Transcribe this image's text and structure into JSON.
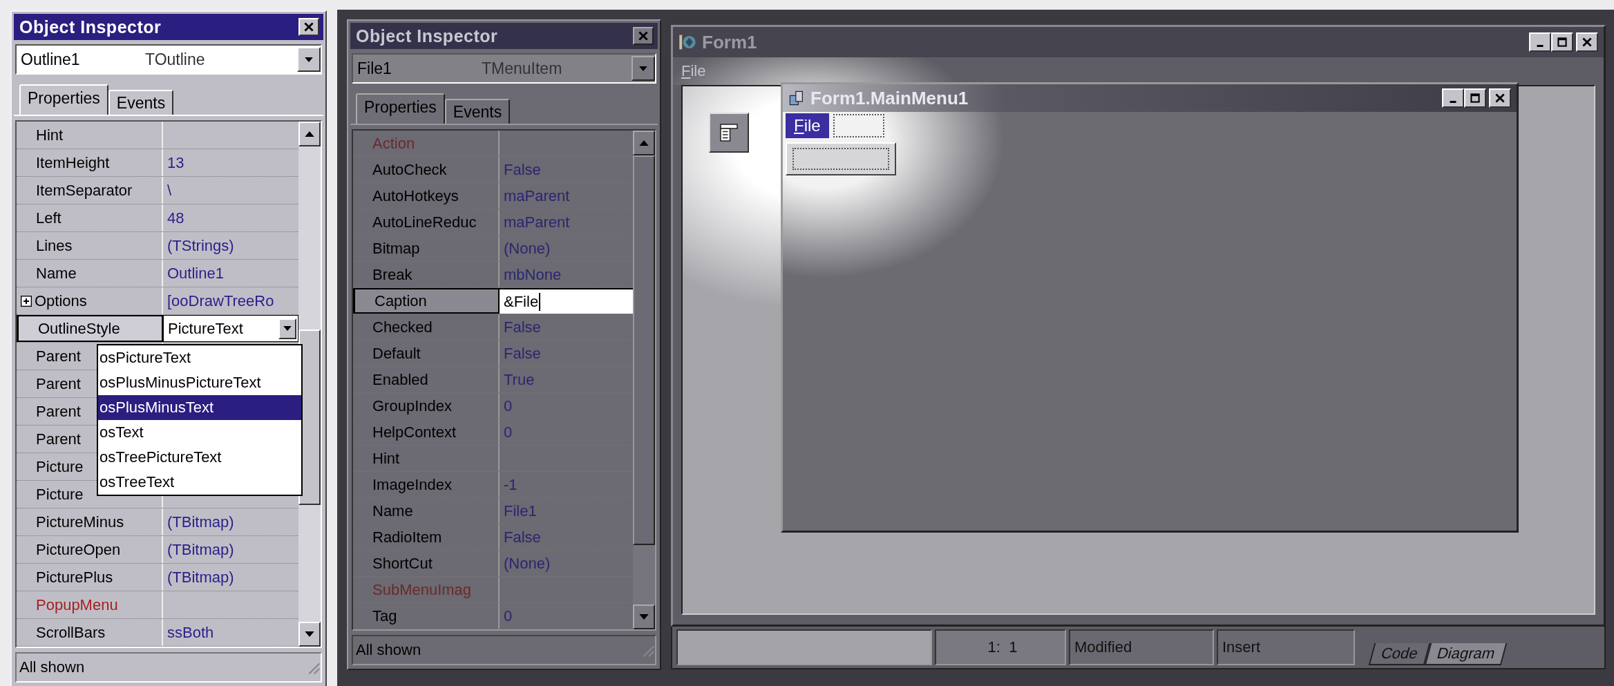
{
  "inspectors": [
    {
      "title": "Object Inspector",
      "dimmed": false,
      "object": {
        "name": "Outline1",
        "type": "TOutline"
      },
      "tabs": [
        {
          "label": "Properties",
          "selected": true
        },
        {
          "label": "Events",
          "selected": false
        }
      ],
      "rows": [
        {
          "name": "Hint",
          "kind": "plain",
          "selected": false
        },
        {
          "name": "ItemHeight",
          "value": "13",
          "kind": "plain",
          "selected": false
        },
        {
          "name": "ItemSeparator",
          "value": "\\",
          "kind": "plain",
          "selected": false
        },
        {
          "name": "Left",
          "value": "48",
          "kind": "plain",
          "selected": false
        },
        {
          "name": "Lines",
          "value": "(TStrings)",
          "kind": "plain",
          "selected": false
        },
        {
          "name": "Name",
          "value": "Outline1",
          "kind": "plain",
          "selected": false
        },
        {
          "name": "Options",
          "value": "[ooDrawTreeRo",
          "kind": "set",
          "selected": false
        },
        {
          "name": "OutlineStyle",
          "value": "PictureText",
          "kind": "combo",
          "selected": true
        },
        {
          "name": "Parent",
          "kind": "plain",
          "selected": false
        },
        {
          "name": "Parent",
          "kind": "plain",
          "selected": false
        },
        {
          "name": "Parent",
          "kind": "plain",
          "selected": false
        },
        {
          "name": "Parent",
          "kind": "plain",
          "selected": false
        },
        {
          "name": "Picture",
          "kind": "plain",
          "selected": false
        },
        {
          "name": "Picture",
          "kind": "plain",
          "selected": false
        },
        {
          "name": "PictureMinus",
          "value": "(TBitmap)",
          "kind": "plain",
          "selected": false
        },
        {
          "name": "PictureOpen",
          "value": "(TBitmap)",
          "kind": "plain",
          "selected": false
        },
        {
          "name": "PicturePlus",
          "value": "(TBitmap)",
          "kind": "plain",
          "selected": false
        },
        {
          "name": "PopupMenu",
          "kind": "reference",
          "selected": false
        },
        {
          "name": "ScrollBars",
          "value": "ssBoth",
          "kind": "plain",
          "selected": false
        }
      ],
      "dropdown": [
        {
          "label": "osPictureText",
          "selected": false
        },
        {
          "label": "osPlusMinusPictureText",
          "selected": false
        },
        {
          "label": "osPlusMinusText",
          "selected": true
        },
        {
          "label": "osText",
          "selected": false
        },
        {
          "label": "osTreePictureText",
          "selected": false
        },
        {
          "label": "osTreeText",
          "selected": false
        }
      ],
      "status": "All shown"
    },
    {
      "title": "Object Inspector",
      "dimmed": true,
      "object": {
        "name": "File1",
        "type": "TMenuItem"
      },
      "tabs": [
        {
          "label": "Properties",
          "selected": true
        },
        {
          "label": "Events",
          "selected": false
        }
      ],
      "rows": [
        {
          "name": "Action",
          "kind": "reference",
          "selected": false
        },
        {
          "name": "AutoCheck",
          "value": "False",
          "kind": "plain",
          "selected": false
        },
        {
          "name": "AutoHotkeys",
          "value": "maParent",
          "kind": "plain",
          "selected": false
        },
        {
          "name": "AutoLineReduc",
          "value": "maParent",
          "kind": "plain",
          "selected": false
        },
        {
          "name": "Bitmap",
          "value": "(None)",
          "kind": "plain",
          "selected": false
        },
        {
          "name": "Break",
          "value": "mbNone",
          "kind": "plain",
          "selected": false
        },
        {
          "name": "Caption",
          "value": "&File",
          "kind": "edit",
          "selected": true
        },
        {
          "name": "Checked",
          "value": "False",
          "kind": "plain",
          "selected": false
        },
        {
          "name": "Default",
          "value": "False",
          "kind": "plain",
          "selected": false
        },
        {
          "name": "Enabled",
          "value": "True",
          "kind": "plain",
          "selected": false
        },
        {
          "name": "GroupIndex",
          "value": "0",
          "kind": "plain",
          "selected": false
        },
        {
          "name": "HelpContext",
          "value": "0",
          "kind": "plain",
          "selected": false
        },
        {
          "name": "Hint",
          "kind": "plain",
          "selected": false
        },
        {
          "name": "ImageIndex",
          "value": "-1",
          "kind": "plain",
          "selected": false
        },
        {
          "name": "Name",
          "value": "File1",
          "kind": "plain",
          "selected": false
        },
        {
          "name": "RadioItem",
          "value": "False",
          "kind": "plain",
          "selected": false
        },
        {
          "name": "ShortCut",
          "value": "(None)",
          "kind": "plain",
          "selected": false
        },
        {
          "name": "SubMenuImag",
          "kind": "reference",
          "selected": false
        },
        {
          "name": "Tag",
          "value": "0",
          "kind": "plain",
          "selected": false
        }
      ],
      "status": "All shown"
    }
  ],
  "form": {
    "title": "Form1",
    "menu": [
      "File"
    ],
    "designer": {
      "title": "Form1.MainMenu1",
      "items": [
        {
          "label": "File",
          "selected": true
        }
      ]
    }
  },
  "editor_status": {
    "panels": [
      "1:  1",
      "Modified",
      "Insert"
    ],
    "tabs": [
      {
        "label": "Code",
        "selected": true
      },
      {
        "label": "Diagram",
        "selected": false
      }
    ]
  }
}
